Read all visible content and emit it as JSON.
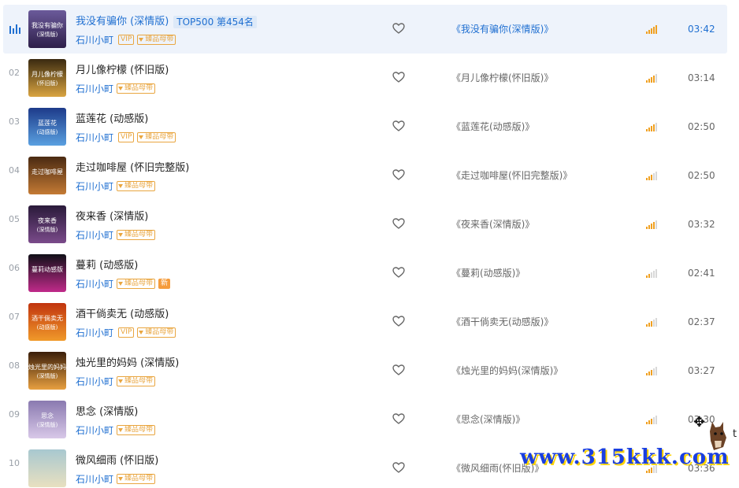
{
  "songs": [
    {
      "index": "",
      "title": "我没有骗你 (深情版)",
      "rank": "TOP500 第454名",
      "artist": "石川小町",
      "vip": true,
      "tape": "臻品母带",
      "new": "",
      "album": "《我没有骗你(深情版)》",
      "duration": "03:42",
      "quality": 5,
      "active": true,
      "cover_text": [
        "我没有骗你",
        "(深情版)"
      ],
      "cover_colors": [
        "#6b5a9a",
        "#2e1f4a"
      ]
    },
    {
      "index": "02",
      "title": "月儿像柠檬 (怀旧版)",
      "rank": "",
      "artist": "石川小町",
      "vip": false,
      "tape": "臻品母带",
      "new": "",
      "album": "《月儿像柠檬(怀旧版)》",
      "duration": "03:14",
      "quality": 4,
      "active": false,
      "cover_text": [
        "月儿像柠檬",
        "(怀旧版)"
      ],
      "cover_colors": [
        "#3a2a10",
        "#d9a441"
      ]
    },
    {
      "index": "03",
      "title": "蓝莲花 (动感版)",
      "rank": "",
      "artist": "石川小町",
      "vip": true,
      "tape": "臻品母带",
      "new": "",
      "album": "《蓝莲花(动感版)》",
      "duration": "02:50",
      "quality": 4,
      "active": false,
      "cover_text": [
        "蓝莲花",
        "(动感版)"
      ],
      "cover_colors": [
        "#1d3b8a",
        "#5aa0e0"
      ]
    },
    {
      "index": "04",
      "title": "走过咖啡屋 (怀旧完整版)",
      "rank": "",
      "artist": "石川小町",
      "vip": false,
      "tape": "臻品母带",
      "new": "",
      "album": "《走过咖啡屋(怀旧完整版)》",
      "duration": "02:50",
      "quality": 3,
      "active": false,
      "cover_text": [
        "走过咖啡屋",
        ""
      ],
      "cover_colors": [
        "#4a2a12",
        "#c47a34"
      ]
    },
    {
      "index": "05",
      "title": "夜来香 (深情版)",
      "rank": "",
      "artist": "石川小町",
      "vip": false,
      "tape": "臻品母带",
      "new": "",
      "album": "《夜来香(深情版)》",
      "duration": "03:32",
      "quality": 4,
      "active": false,
      "cover_text": [
        "夜来香",
        "(深情版)"
      ],
      "cover_colors": [
        "#2a1a3a",
        "#7a4a8a"
      ]
    },
    {
      "index": "06",
      "title": "蔓莉 (动感版)",
      "rank": "",
      "artist": "石川小町",
      "vip": false,
      "tape": "臻品母带",
      "new": "新",
      "album": "《蔓莉(动感版)》",
      "duration": "02:41",
      "quality": 2,
      "active": false,
      "cover_text": [
        "蔓莉动感版",
        ""
      ],
      "cover_colors": [
        "#101018",
        "#c02a8a"
      ]
    },
    {
      "index": "07",
      "title": "酒干倘卖无 (动感版)",
      "rank": "",
      "artist": "石川小町",
      "vip": true,
      "tape": "臻品母带",
      "new": "",
      "album": "《酒干倘卖无(动感版)》",
      "duration": "02:37",
      "quality": 3,
      "active": false,
      "cover_text": [
        "酒干倘卖无",
        "(动感版)"
      ],
      "cover_colors": [
        "#c0340e",
        "#f09a2a"
      ]
    },
    {
      "index": "08",
      "title": "烛光里的妈妈 (深情版)",
      "rank": "",
      "artist": "石川小町",
      "vip": false,
      "tape": "臻品母带",
      "new": "",
      "album": "《烛光里的妈妈(深情版)》",
      "duration": "03:27",
      "quality": 3,
      "active": false,
      "cover_text": [
        "烛光里的妈妈",
        "(深情版)"
      ],
      "cover_colors": [
        "#3a1e0a",
        "#e8a040"
      ]
    },
    {
      "index": "09",
      "title": "思念 (深情版)",
      "rank": "",
      "artist": "石川小町",
      "vip": false,
      "tape": "臻品母带",
      "new": "",
      "album": "《思念(深情版)》",
      "duration": "03:30",
      "quality": 3,
      "active": false,
      "cover_text": [
        "思念",
        "(深情版)"
      ],
      "cover_colors": [
        "#8a7ab0",
        "#d8c8e8"
      ]
    },
    {
      "index": "10",
      "title": "微风细雨 (怀旧版)",
      "rank": "",
      "artist": "石川小町",
      "vip": false,
      "tape": "臻品母带",
      "new": "",
      "album": "《微风细雨(怀旧版)》",
      "duration": "03:36",
      "quality": 3,
      "active": false,
      "cover_text": [
        "",
        ""
      ],
      "cover_colors": [
        "#a8c8d0",
        "#e8e0c0"
      ]
    }
  ],
  "labels": {
    "vip": "VIP"
  },
  "overlay": {
    "watermark": "www.315kkk.com",
    "side_text": "t",
    "cursor_icon": "move-cursor-icon",
    "mascot_icon": "horse-mascot-icon"
  },
  "colors": {
    "accent": "#1f6fd1",
    "quality_on": "#f0a020",
    "quality_off": "#d8d8d8",
    "badge": "#e9a640"
  }
}
